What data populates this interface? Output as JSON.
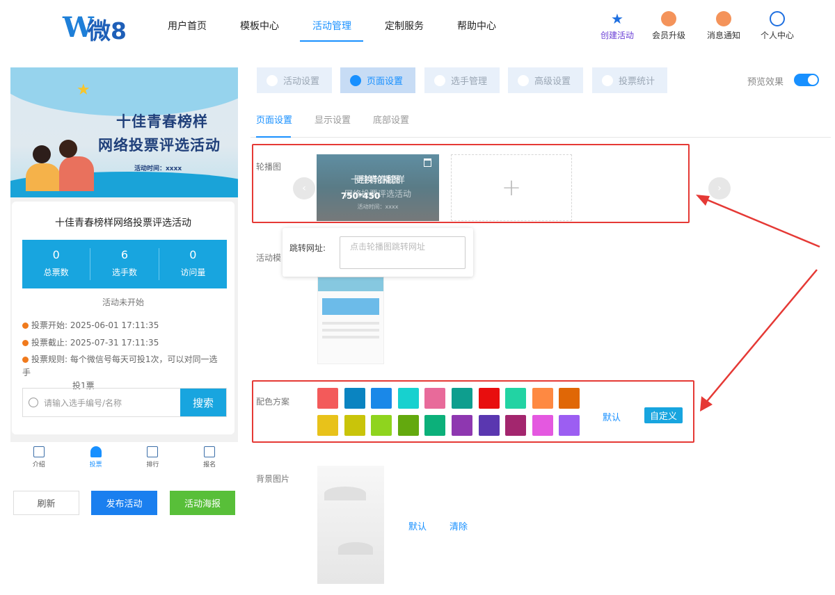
{
  "brand": {
    "logo_letter": "W",
    "logo_text": "微8"
  },
  "nav": {
    "items": [
      {
        "label": "用户首页"
      },
      {
        "label": "模板中心"
      },
      {
        "label": "活动管理",
        "active": true
      },
      {
        "label": "定制服务"
      },
      {
        "label": "帮助中心"
      }
    ]
  },
  "header_right": [
    {
      "label": "创建活动",
      "icon": "star-icon",
      "color": "#6a3fd6"
    },
    {
      "label": "会员升级",
      "icon": "crown-icon",
      "color": "#f07a3a"
    },
    {
      "label": "消息通知",
      "icon": "bell-icon",
      "color": "#f07a3a"
    },
    {
      "label": "个人中心",
      "icon": "user-icon",
      "color": "#1e7fd8"
    }
  ],
  "preview": {
    "banner_title_1": "十佳青春榜样",
    "banner_title_2": "网络投票评选活动",
    "banner_time": "活动时间：xxxx",
    "activity_title": "十佳青春榜样网络投票评选活动",
    "stats": [
      {
        "value": "0",
        "label": "总票数"
      },
      {
        "value": "6",
        "label": "选手数"
      },
      {
        "value": "0",
        "label": "访问量"
      }
    ],
    "status": "活动未开始",
    "vote_start_label": "投票开始:",
    "vote_start": "2025-06-01 17:11:35",
    "vote_end_label": "投票截止:",
    "vote_end": "2025-07-31 17:11:35",
    "rule_label": "投票规则:",
    "rule_line1": "每个微信号每天可投1次，可以对同一选手",
    "rule_line2": "投1票",
    "search_placeholder": "请输入选手编号/名称",
    "search_button": "搜索",
    "tabbar": [
      {
        "label": "介绍",
        "icon": "document-icon"
      },
      {
        "label": "投票",
        "icon": "vote-user-icon",
        "active": true
      },
      {
        "label": "排行",
        "icon": "ranking-icon"
      },
      {
        "label": "报名",
        "icon": "signup-icon"
      }
    ]
  },
  "bottom_buttons": {
    "refresh": "刷新",
    "publish": "发布活动",
    "poster": "活动海报"
  },
  "panel_tabs": [
    {
      "label": "活动设置",
      "icon": "heart-icon"
    },
    {
      "label": "页面设置",
      "icon": "layout-icon",
      "active": true
    },
    {
      "label": "选手管理",
      "icon": "person-icon"
    },
    {
      "label": "高级设置",
      "icon": "settings-icon"
    },
    {
      "label": "投票统计",
      "icon": "stats-icon"
    }
  ],
  "preview_toggle": {
    "label": "预览效果",
    "on": true
  },
  "sub_tabs": [
    {
      "label": "页面设置",
      "active": true
    },
    {
      "label": "显示设置"
    },
    {
      "label": "底部设置"
    }
  ],
  "carousel": {
    "label": "轮播图",
    "replace": "更换轮播图",
    "size": "750*450",
    "banner_line_1": "十佳青春榜样",
    "banner_line_2": "网络投票评选活动",
    "banner_time": "活动时间：xxxx",
    "add_symbol": "+",
    "prev": "‹",
    "next": "›"
  },
  "jump_popup": {
    "label": "跳转网址:",
    "placeholder": "点击轮播图跳转网址"
  },
  "template": {
    "label": "活动模"
  },
  "color_scheme": {
    "label": "配色方案",
    "colors": [
      "#f35a5a",
      "#0a84c1",
      "#1a88e8",
      "#17d1cf",
      "#e86a9a",
      "#0e9e8e",
      "#e80e0e",
      "#22d3a3",
      "#fe8942",
      "#e06706",
      "#e8c21a",
      "#c9c40a",
      "#8fd41e",
      "#63a90e",
      "#0cb07a",
      "#8e37b0",
      "#5a37b0",
      "#a3266e",
      "#e458e0",
      "#9c5ef2"
    ],
    "default": "默认",
    "custom": "自定义"
  },
  "background": {
    "label": "背景图片",
    "default": "默认",
    "clear": "清除"
  }
}
